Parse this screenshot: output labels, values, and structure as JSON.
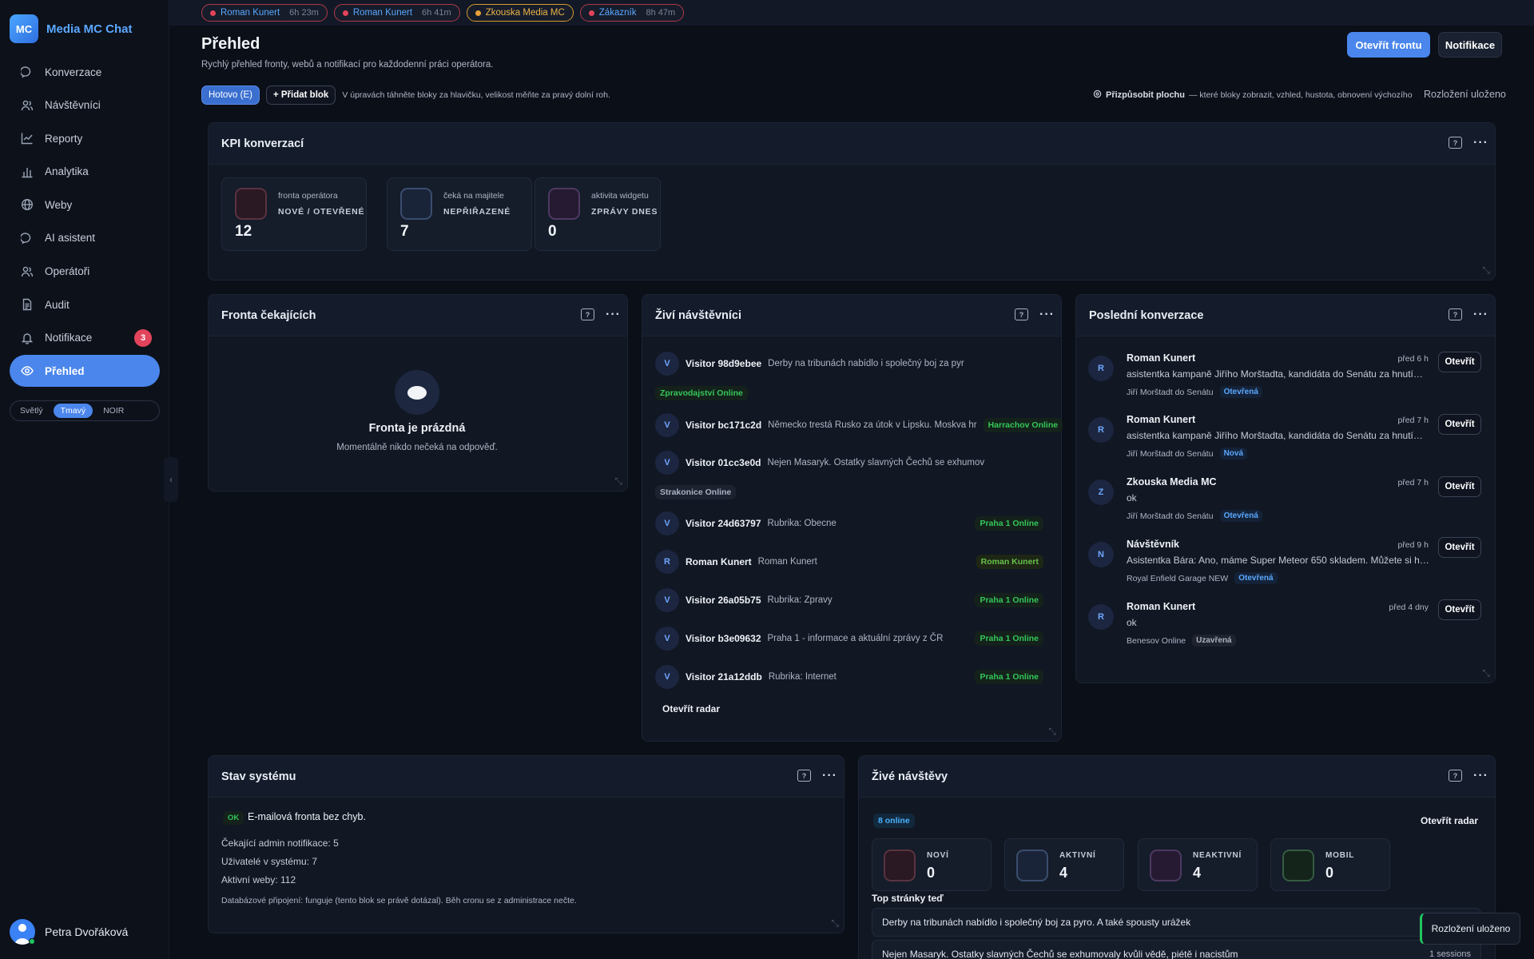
{
  "brand": {
    "logo": "MC",
    "name": "Media MC Chat"
  },
  "sidebar": {
    "items": [
      {
        "label": "Konverzace",
        "icon": "chat-icon"
      },
      {
        "label": "Návštěvníci",
        "icon": "users-icon"
      },
      {
        "label": "Reporty",
        "icon": "line-chart-icon"
      },
      {
        "label": "Analytika",
        "icon": "bar-chart-icon"
      },
      {
        "label": "Weby",
        "icon": "globe-icon"
      },
      {
        "label": "AI asistent",
        "icon": "chat-icon"
      },
      {
        "label": "Operátoři",
        "icon": "users-icon"
      },
      {
        "label": "Audit",
        "icon": "document-icon"
      },
      {
        "label": "Notifikace",
        "icon": "bell-icon",
        "badge": "3"
      },
      {
        "label": "Přehled",
        "icon": "eye-icon",
        "active": true
      }
    ],
    "theme": {
      "light": "Světlý",
      "dark": "Tmavý",
      "noir": "NOIR",
      "selected": "Tmavý"
    },
    "user": {
      "name": "Petra Dvořáková"
    }
  },
  "top_chips": [
    {
      "name": "Roman Kunert",
      "time": "6h 23m",
      "state": "alert"
    },
    {
      "name": "Roman Kunert",
      "time": "6h 41m",
      "state": "alert"
    },
    {
      "name": "Zkouska Media MC",
      "time": "",
      "state": "warn"
    },
    {
      "name": "Zákazník",
      "time": "8h 47m",
      "state": "alert"
    }
  ],
  "header": {
    "title": "Přehled",
    "subtitle": "Rychlý přehled fronty, webů a notifikací pro každodenní práci operátora.",
    "open_queue": "Otevřít frontu",
    "notifications": "Notifikace",
    "done_button": "Hotovo (E)",
    "add_block": "+ Přidat blok",
    "edit_hint": "V úpravách táhněte bloky za hlavičku, velikost měňte za pravý dolní roh.",
    "customize_label": "Přizpůsobit plochu",
    "customize_hint": "— které bloky zobrazit, vzhled, hustota, obnovení výchozího",
    "layout_saved": "Rozložení uloženo"
  },
  "kpi_card": {
    "title": "KPI konverzací",
    "items": [
      {
        "caption": "fronta operátora",
        "label": "NOVÉ / OTEVŘENÉ",
        "value": "12",
        "color": "#5a3340"
      },
      {
        "caption": "čeká na majitele",
        "label": "NEPŘIŘAZENÉ",
        "value": "7",
        "color": "#3a4d6e"
      },
      {
        "caption": "aktivita widgetu",
        "label": "ZPRÁVY DNES",
        "value": "0",
        "color": "#4d3960"
      }
    ]
  },
  "queue_card": {
    "title": "Fronta čekajících",
    "empty_title": "Fronta je prázdná",
    "empty_sub": "Momentálně nikdo nečeká na odpověď."
  },
  "live_visitors_card": {
    "title": "Živí návštěvníci",
    "rows": [
      {
        "initial": "V",
        "name": "Visitor 98d9ebee",
        "page": "Derby na tribunách nabídlo i společný boj za pyr",
        "status": "Zpravodajství Online"
      },
      {
        "initial": "V",
        "name": "Visitor bc171c2d",
        "page": "Německo trestá Rusko za útok v Lipsku. Moskva hr",
        "status": "Harrachov Online"
      },
      {
        "initial": "V",
        "name": "Visitor 01cc3e0d",
        "page": "Nejen Masaryk. Ostatky slavných Čechů se exhumov",
        "status": "Strakonice Online"
      },
      {
        "initial": "V",
        "name": "Visitor 24d63797",
        "page": "Rubrika: Obecne",
        "status": "Praha 1 Online"
      },
      {
        "initial": "R",
        "name": "Roman Kunert",
        "page": "Roman Kunert",
        "status": "Roman Kunert"
      },
      {
        "initial": "V",
        "name": "Visitor 26a05b75",
        "page": "Rubrika: Zpravy",
        "status": "Praha 1 Online"
      },
      {
        "initial": "V",
        "name": "Visitor b3e09632",
        "page": "Praha 1 - informace a aktuální zprávy z ČR",
        "status": "Praha 1 Online"
      },
      {
        "initial": "V",
        "name": "Visitor 21a12ddb",
        "page": "Rubrika: Internet",
        "status": "Praha 1 Online"
      }
    ],
    "open_radar": "Otevřít radar"
  },
  "recent_card": {
    "title": "Poslední konverzace",
    "open_label": "Otevřít",
    "rows": [
      {
        "initial": "R",
        "name": "Roman Kunert",
        "when": "před 6 h",
        "msg": "asistentka kampaně Jiřího Morštadta, kandidáta do Senátu za hnutí…",
        "source": "Jiří Morštadt do Senátu",
        "tag": "Otevřená"
      },
      {
        "initial": "R",
        "name": "Roman Kunert",
        "when": "před 7 h",
        "msg": "asistentka kampaně Jiřího Morštadta, kandidáta do Senátu za hnutí…",
        "source": "Jiří Morštadt do Senátu",
        "tag": "Nová"
      },
      {
        "initial": "Z",
        "name": "Zkouska Media MC",
        "when": "před 7 h",
        "msg": "ok",
        "source": "Jiří Morštadt do Senátu",
        "tag": "Otevřená"
      },
      {
        "initial": "N",
        "name": "Návštěvník",
        "when": "před 9 h",
        "msg": "Asistentka Bára: Ano, máme Super Meteor 650 skladem. Můžete si h…",
        "source": "Royal Enfield Garage NEW",
        "tag": "Otevřená"
      },
      {
        "initial": "R",
        "name": "Roman Kunert",
        "when": "před 4 dny",
        "msg": "ok",
        "source": "Benesov Online",
        "tag": "Uzavřená"
      }
    ]
  },
  "system_card": {
    "title": "Stav systému",
    "ok_badge": "OK",
    "ok_text": "E-mailová fronta bez chyb.",
    "lines": [
      "Čekající admin notifikace: 5",
      "Uživatelé v systému: 7",
      "Aktivní weby: 112"
    ],
    "note": "Databázové připojení: funguje (tento blok se právě dotázal). Běh cronu se z administrace nečte."
  },
  "live_visits_card": {
    "title": "Živé návštěvy",
    "online": "8 online",
    "open_radar": "Otevřít radar",
    "stats": [
      {
        "label": "NOVÍ",
        "value": "0",
        "color": "#5a3340"
      },
      {
        "label": "AKTIVNÍ",
        "value": "4",
        "color": "#3a4d6e"
      },
      {
        "label": "NEAKTIVNÍ",
        "value": "4",
        "color": "#4d3960"
      },
      {
        "label": "MOBIL",
        "value": "0",
        "color": "#355c41"
      }
    ],
    "top_pages_title": "Top stránky teď",
    "top_pages": [
      {
        "title": "Derby na tribunách nabídlo i společný boj za pyro. A také spousty urážek",
        "sessions": ""
      },
      {
        "title": "Nejen Masaryk. Ostatky slavných Čechů se exhumovaly kvůli vědě, piétě i nacistům",
        "sessions": "1 sessions"
      }
    ]
  },
  "toast": "Rozložení uloženo"
}
